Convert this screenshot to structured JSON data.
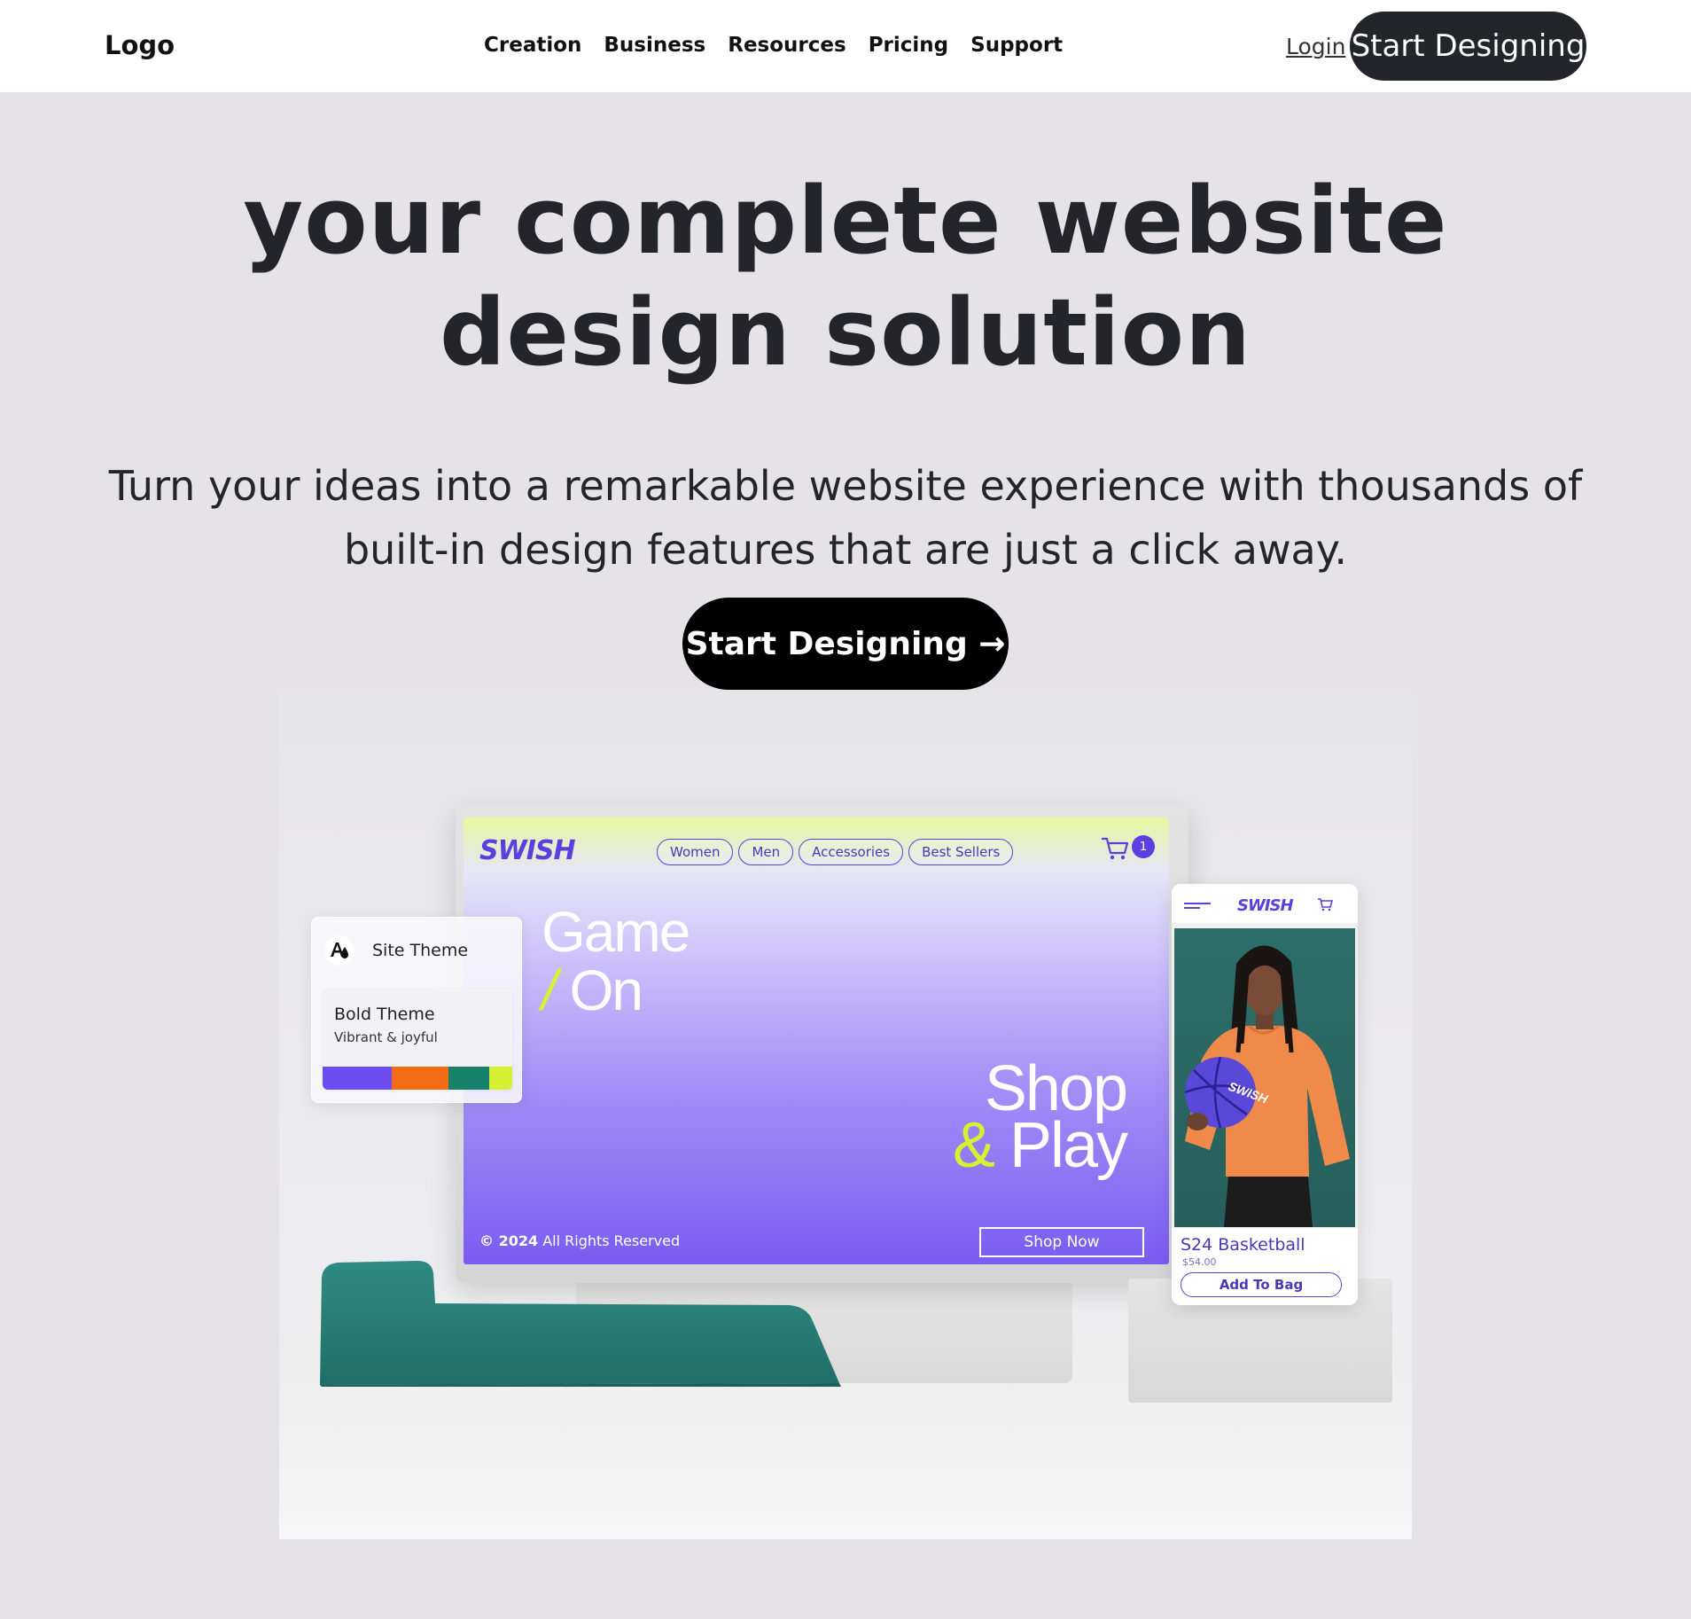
{
  "nav": {
    "logo": "Logo",
    "links": [
      "Creation",
      "Business",
      "Resources",
      "Pricing",
      "Support"
    ],
    "login": "Login",
    "cta": "Start Designing"
  },
  "hero": {
    "title": "your complete website design solution",
    "subtitle": "Turn your ideas into a remarkable website experience with thousands of built-in design features that are just a click away.",
    "cta": "Start Designing →"
  },
  "mockup": {
    "site_logo": "SWISH",
    "site_nav": [
      "Women",
      "Men",
      "Accessories",
      "Best Sellers"
    ],
    "cart_count": "1",
    "headline_1": "Game",
    "headline_slash": "/",
    "headline_2": "On",
    "tagline_1": "Shop",
    "tagline_amp": "&",
    "tagline_2": "Play",
    "copyright_year": "© 2024",
    "copyright_text": "All Rights Reserved",
    "shop_now": "Shop Now",
    "theme_card": {
      "title": "Site Theme",
      "theme_name": "Bold Theme",
      "theme_desc": "Vibrant & joyful",
      "swatches": [
        "#6a4cf0",
        "#f26b15",
        "#15816b",
        "#d6f032"
      ]
    },
    "phone": {
      "logo": "SWISH",
      "product_name": "S24 Basketball",
      "product_price": "$54.00",
      "add_to_bag": "Add To Bag",
      "ball_text": "SWISH"
    }
  },
  "colors": {
    "page_bg": "#e5e3e8",
    "nav_bg": "#ffffff",
    "cta_dark": "#23252b",
    "cta_black": "#000000",
    "accent_purple": "#5b3fe0",
    "accent_lime": "#d6f032"
  }
}
